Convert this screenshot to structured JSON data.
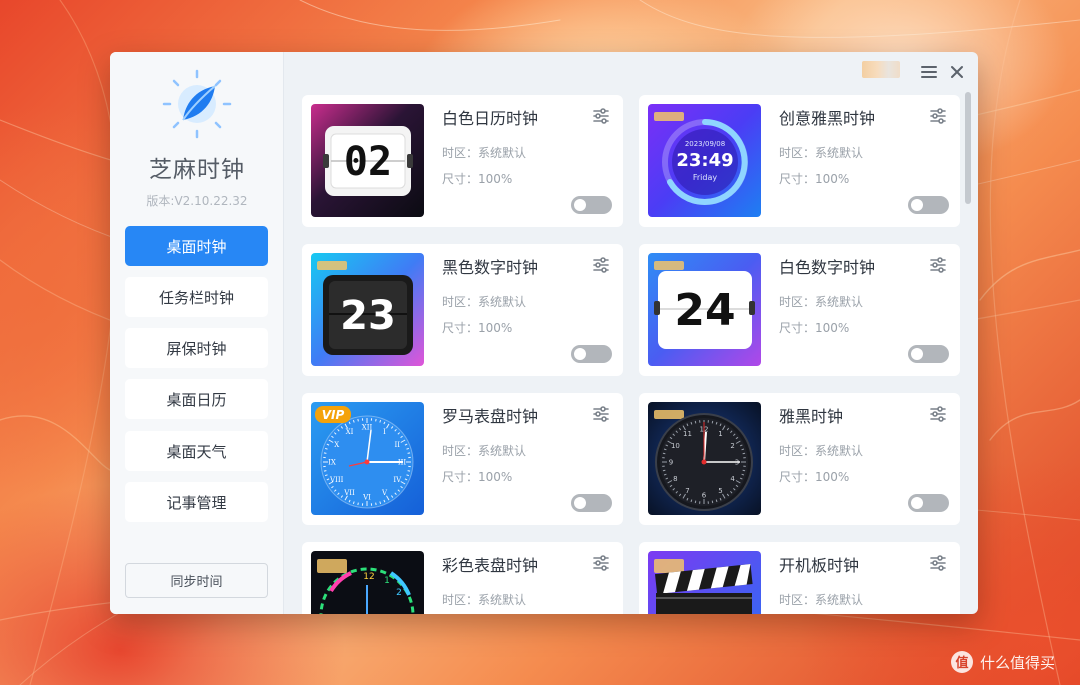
{
  "app": {
    "name": "芝麻时钟",
    "version": "版本:V2.10.22.32"
  },
  "sidebar": {
    "items": [
      {
        "label": "桌面时钟",
        "active": true
      },
      {
        "label": "任务栏时钟",
        "active": false
      },
      {
        "label": "屏保时钟",
        "active": false
      },
      {
        "label": "桌面日历",
        "active": false
      },
      {
        "label": "桌面天气",
        "active": false
      },
      {
        "label": "记事管理",
        "active": false
      }
    ],
    "sync_button": "同步时间"
  },
  "cards": [
    {
      "title": "白色日历时钟",
      "timezone": "时区：系统默认",
      "size": "尺寸：100%",
      "enabled": false,
      "thumb": {
        "digits": "02"
      }
    },
    {
      "title": "创意雅黑时钟",
      "timezone": "时区：系统默认",
      "size": "尺寸：100%",
      "enabled": false,
      "thumb": {
        "date": "2023/09/08",
        "time": "23:49",
        "day": "Friday"
      }
    },
    {
      "title": "黑色数字时钟",
      "timezone": "时区：系统默认",
      "size": "尺寸：100%",
      "enabled": false,
      "thumb": {
        "digits": "23"
      }
    },
    {
      "title": "白色数字时钟",
      "timezone": "时区：系统默认",
      "size": "尺寸：100%",
      "enabled": false,
      "thumb": {
        "digits": "24"
      }
    },
    {
      "title": "罗马表盘时钟",
      "timezone": "时区：系统默认",
      "size": "尺寸：100%",
      "enabled": false,
      "thumb": {
        "badge": "VIP",
        "numerals": [
          "XII",
          "I",
          "II",
          "III",
          "IV",
          "V",
          "VI",
          "VII",
          "VIII",
          "IX",
          "X",
          "XI"
        ]
      }
    },
    {
      "title": "雅黑时钟",
      "timezone": "时区：系统默认",
      "size": "尺寸：100%",
      "enabled": false,
      "thumb": {
        "numerals": [
          "12",
          "1",
          "2",
          "3",
          "4",
          "5",
          "6",
          "7",
          "8",
          "9",
          "10",
          "11"
        ]
      }
    },
    {
      "title": "彩色表盘时钟",
      "timezone": "时区：系统默认",
      "size": "",
      "enabled": false,
      "thumb": {
        "numerals": [
          "12",
          "1",
          "2"
        ]
      }
    },
    {
      "title": "开机板时钟",
      "timezone": "时区：系统默认",
      "size": "",
      "enabled": false,
      "thumb": {}
    }
  ],
  "watermark": "值 | 什么值得买",
  "colors": {
    "accent": "#2787f5",
    "toggle_off": "#b2b6bb",
    "window_bg": "#eef2f6"
  }
}
